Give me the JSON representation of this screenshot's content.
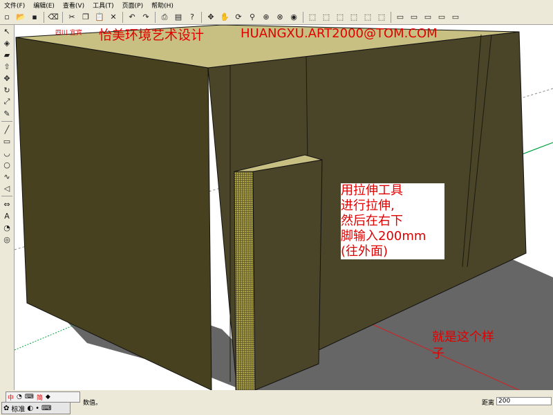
{
  "menu": [
    "文件(F)",
    "编辑(E)",
    "查看(V)",
    "工具(T)",
    "页面(P)",
    "帮助(H)"
  ],
  "header": {
    "location": "四川 宜宾",
    "title": "怡美环境艺术设计",
    "email": "HUANGXU.ART2000@TOM.COM"
  },
  "annotations": {
    "instruction_lines": [
      "用拉伸工具",
      "进行拉伸,",
      "然后在右下",
      "脚输入200mm",
      "(往外面)"
    ],
    "result_lines": [
      "就是这个样",
      "子"
    ]
  },
  "ime": {
    "top": [
      "中",
      "简"
    ],
    "mode": "标准"
  },
  "status": {
    "prompt": "数值。",
    "distance_label": "距离",
    "distance_value": "200"
  },
  "colors": {
    "wall_front": "#4a4428",
    "wall_side": "#3e3921",
    "top": "#c8c082",
    "shadow": "#6a6a6a",
    "annotation": "#e00000",
    "axis_green": "#00a040",
    "axis_red": "#d02020"
  },
  "icons": {
    "toolbar": [
      "new-icon",
      "open-icon",
      "save-icon",
      "eraser-icon",
      "cut-icon",
      "copy-icon",
      "paste-icon",
      "delete-icon",
      "undo-icon",
      "redo-icon",
      "print-icon",
      "model-info-icon",
      "help-icon",
      "move-icon",
      "pan-icon",
      "orbit-icon",
      "zoom-icon",
      "zoom-window-icon",
      "zoom-extents-icon",
      "previous-view-icon",
      "iso-view-icon",
      "top-view-icon",
      "front-view-icon",
      "right-view-icon",
      "back-view-icon",
      "left-view-icon",
      "xray-icon",
      "wireframe-icon",
      "hidden-line-icon",
      "shaded-icon",
      "shaded-texture-icon"
    ],
    "left": [
      "select-icon",
      "paint-bucket-icon",
      "eraser-icon",
      "push-pull-icon",
      "move-icon",
      "rotate-icon",
      "scale-icon",
      "tape-measure-icon",
      "line-icon",
      "rectangle-icon",
      "arc-icon",
      "circle-icon",
      "freehand-icon",
      "polygon-icon",
      "dimension-icon",
      "text-icon",
      "protractor-icon",
      "offset-icon"
    ]
  }
}
